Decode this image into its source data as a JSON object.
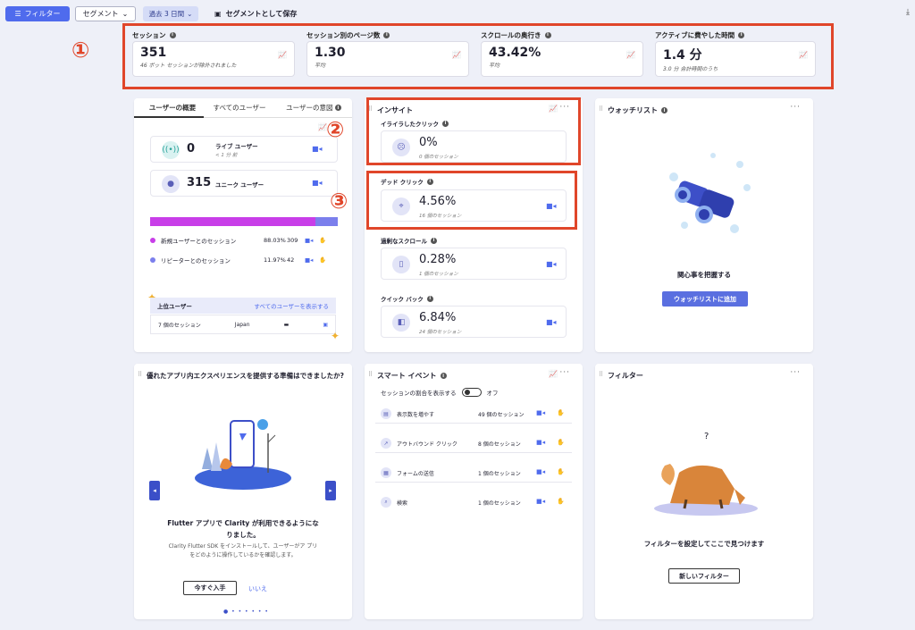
{
  "topbar": {
    "filter_label": "フィルター",
    "segment_label": "セグメント",
    "days_label": "過去 3 日間",
    "save_label": "セグメントとして保存"
  },
  "metrics": [
    {
      "title": "セッション",
      "value": "351",
      "sub": "46 ボット セッションが除外されました"
    },
    {
      "title": "セッション別のページ数",
      "value": "1.30",
      "sub": "平均"
    },
    {
      "title": "スクロールの奥行き",
      "value": "43.42%",
      "sub": "平均"
    },
    {
      "title": "アクティブに費やした時間",
      "value": "1.4 分",
      "sub": "3.0 分 合計時間のうち"
    }
  ],
  "annotations": {
    "one": "①",
    "two": "②",
    "three": "③"
  },
  "users": {
    "tabs": [
      "ユーザーの概要",
      "すべてのユーザー",
      "ユーザーの意図"
    ],
    "live": {
      "value": "0",
      "label": "ライブ ユーザー",
      "sub": "< 1 分 前"
    },
    "unique": {
      "value": "315",
      "label": "ユニーク ユーザー"
    },
    "new_share": 88.03,
    "new": {
      "label": "新規ユーザーとのセッション",
      "pct": "88.03%",
      "count": "309"
    },
    "returning": {
      "label": "リピーターとのセッション",
      "pct": "11.97%",
      "count": "42"
    },
    "top_title": "上位ユーザー",
    "show_all": "すべてのユーザーを表示する",
    "top_row": {
      "sessions": "7 個のセッション",
      "country": "Japan"
    },
    "colors": {
      "new": "#c83ee8",
      "returning": "#7b7fec"
    }
  },
  "insights": {
    "title": "インサイト",
    "items": [
      {
        "label": "イライラしたクリック",
        "value": "0%",
        "sub": "0 個のセッション"
      },
      {
        "label": "デッド クリック",
        "value": "4.56%",
        "sub": "16 個のセッション"
      },
      {
        "label": "過剰なスクロール",
        "value": "0.28%",
        "sub": "1 個のセッション"
      },
      {
        "label": "クイック バック",
        "value": "6.84%",
        "sub": "24 個のセッション"
      }
    ]
  },
  "watchlist": {
    "title": "ウォッチリスト",
    "caption": "関心事を把握する",
    "button": "ウォッチリストに追加"
  },
  "promo": {
    "title": "優れたアプリ内エクスペリエンスを提供する準備はできましたか?",
    "headline": "Flutter アプリで Clarity が利用できるようにな りました。",
    "body": "Clarity Flutter SDK をインストールして、ユーザーがア プリをどのように操作しているかを確認します。",
    "primary": "今すぐ入手",
    "secondary": "いいえ"
  },
  "smart_events": {
    "title": "スマート イベント",
    "toggle_label": "セッションの割合を表示する",
    "toggle_state": "オフ",
    "rows": [
      {
        "name": "表示数を増やす",
        "count": "49 個のセッション"
      },
      {
        "name": "アウトバウンド クリック",
        "count": "8 個のセッション"
      },
      {
        "name": "フォームの送信",
        "count": "1 個のセッション"
      },
      {
        "name": "検索",
        "count": "1 個のセッション"
      }
    ]
  },
  "filters": {
    "title": "フィルター",
    "question": "?",
    "caption": "フィルターを設定してここで見つけます",
    "button": "新しいフィルター"
  }
}
